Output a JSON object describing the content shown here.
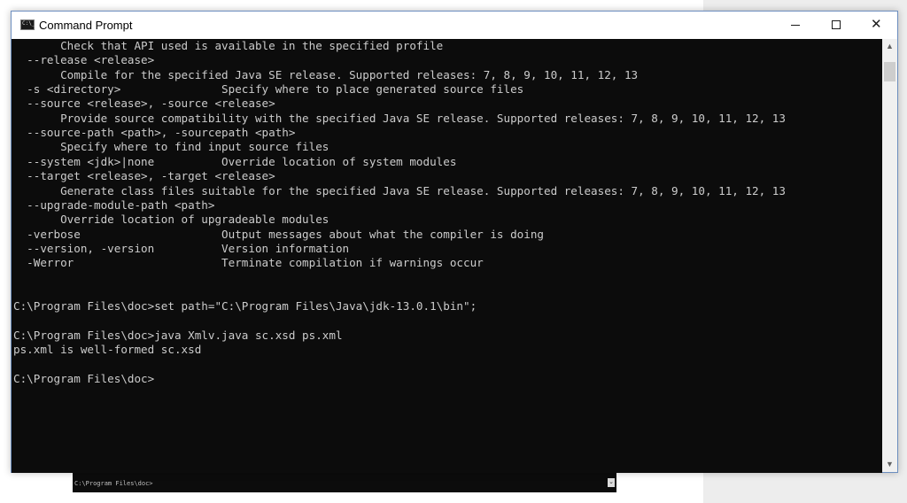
{
  "window": {
    "title": "Command Prompt",
    "icon_label": "C:\\_",
    "controls": {
      "minimize": "",
      "maximize": "",
      "close": "✕"
    }
  },
  "console": {
    "lines": [
      "       Check that API used is available in the specified profile",
      "  --release <release>",
      "       Compile for the specified Java SE release. Supported releases: 7, 8, 9, 10, 11, 12, 13",
      "  -s <directory>               Specify where to place generated source files",
      "  --source <release>, -source <release>",
      "       Provide source compatibility with the specified Java SE release. Supported releases: 7, 8, 9, 10, 11, 12, 13",
      "  --source-path <path>, -sourcepath <path>",
      "       Specify where to find input source files",
      "  --system <jdk>|none          Override location of system modules",
      "  --target <release>, -target <release>",
      "       Generate class files suitable for the specified Java SE release. Supported releases: 7, 8, 9, 10, 11, 12, 13",
      "  --upgrade-module-path <path>",
      "       Override location of upgradeable modules",
      "  -verbose                     Output messages about what the compiler is doing",
      "  --version, -version          Version information",
      "  -Werror                      Terminate compilation if warnings occur",
      "",
      "",
      "C:\\Program Files\\doc>set path=\"C:\\Program Files\\Java\\jdk-13.0.1\\bin\";",
      "",
      "C:\\Program Files\\doc>java Xmlv.java sc.xsd ps.xml",
      "ps.xml is well-formed sc.xsd",
      "",
      "C:\\Program Files\\doc>"
    ]
  },
  "background_terminal": {
    "prompt": "C:\\Program Files\\doc>"
  },
  "scrollbar": {
    "up": "▲",
    "down": "▼"
  },
  "colors": {
    "console_bg": "#0c0c0c",
    "console_text": "#cccccc",
    "titlebar_bg": "#ffffff"
  }
}
